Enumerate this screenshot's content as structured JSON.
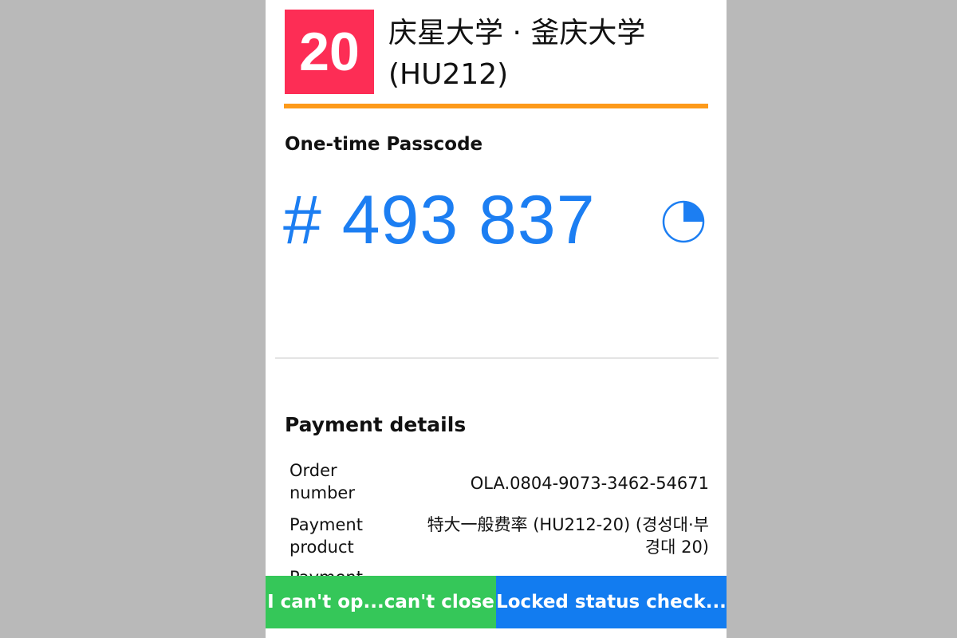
{
  "route": {
    "number": "20",
    "title_line1": "庆星大学 · 釜庆大学",
    "title_line2": "(HU212)",
    "badge_color": "#fd2d55",
    "accent_color": "#fd9a1a"
  },
  "passcode": {
    "label": "One-time Passcode",
    "code": "# 493 837",
    "timer_icon": "countdown-pie-icon",
    "timer_fraction_elapsed": 0.25,
    "color": "#1c7ef2"
  },
  "payment": {
    "title": "Payment details",
    "rows": [
      {
        "key": "Order number",
        "value": "OLA.0804-9073-3462-54671"
      },
      {
        "key": "Payment product",
        "value": "特大一般费率 (HU212-20) (경성대·부경대 20)"
      },
      {
        "key": "Payment",
        "value": ""
      }
    ]
  },
  "actions": {
    "left_label": "I can't op...can't close",
    "right_label": "Locked status check...",
    "left_color": "#35c759",
    "right_color": "#127cf0"
  }
}
